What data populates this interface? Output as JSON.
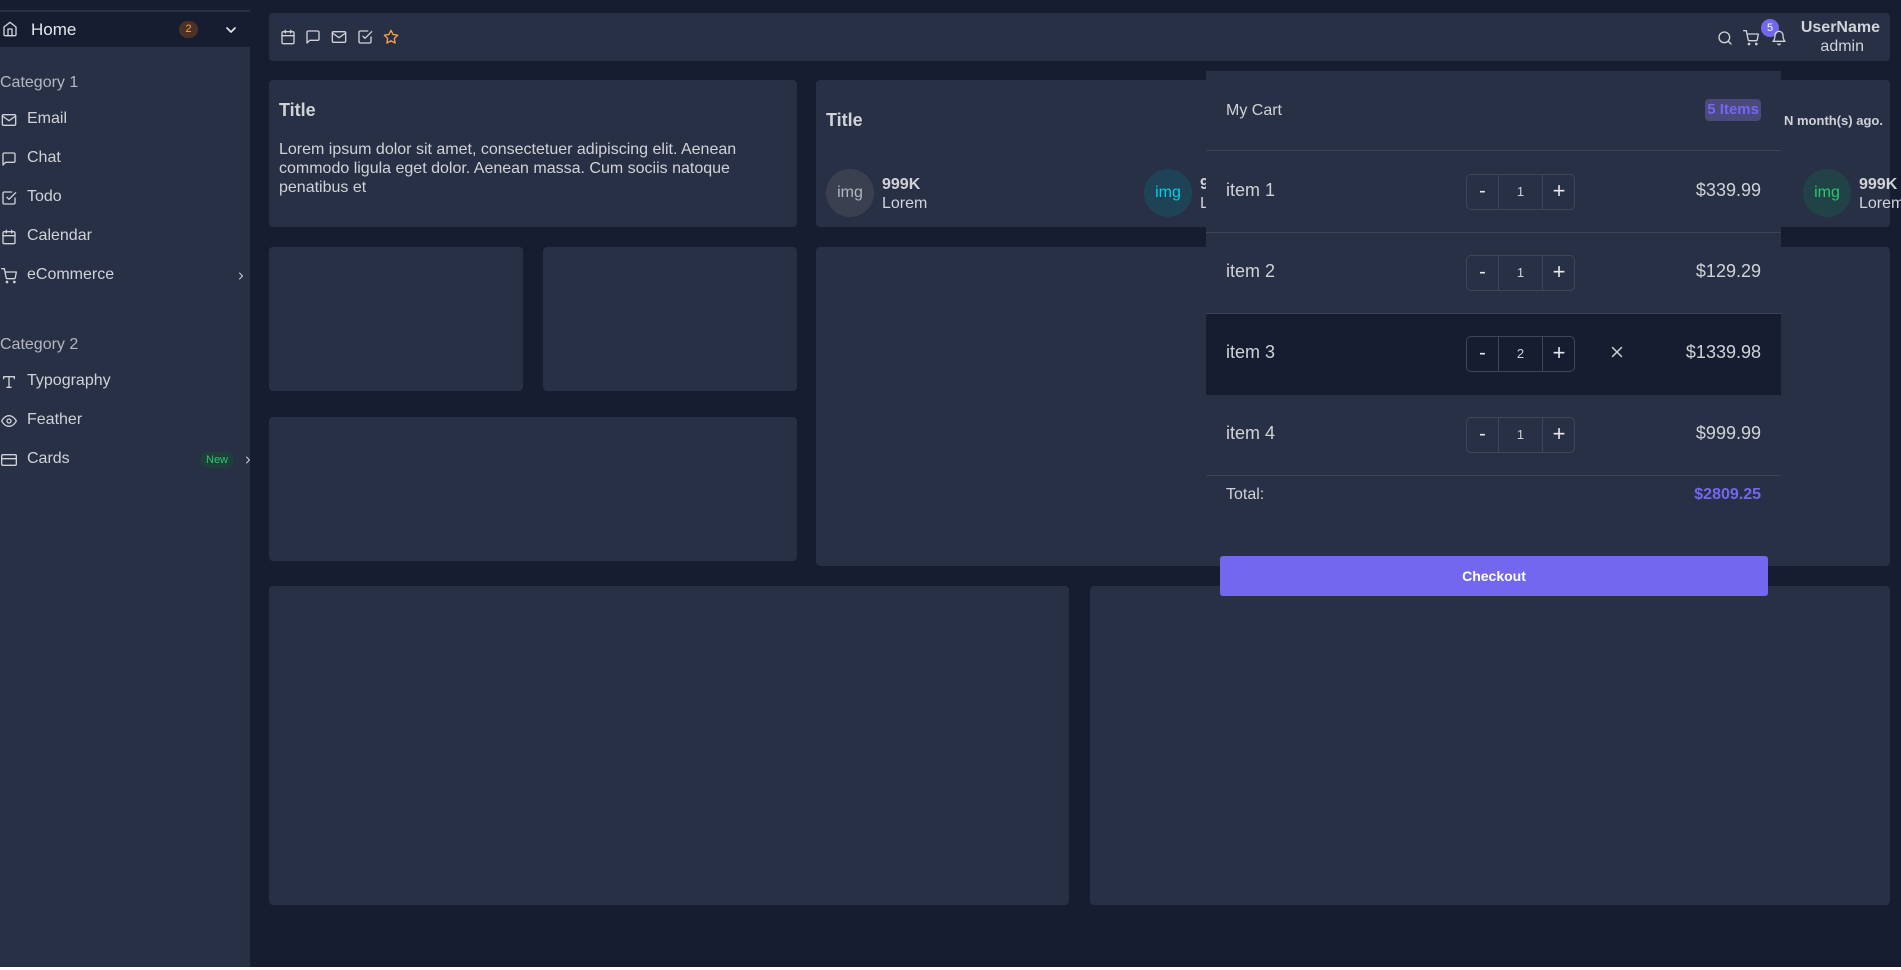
{
  "sidebar": {
    "home": {
      "label": "Home",
      "badge": "2"
    },
    "categories": [
      {
        "label": "Category 1"
      },
      {
        "label": "Category 2"
      }
    ],
    "items": [
      {
        "label": "Email",
        "icon": "mail-icon"
      },
      {
        "label": "Chat",
        "icon": "message-square-icon"
      },
      {
        "label": "Todo",
        "icon": "check-square-icon"
      },
      {
        "label": "Calendar",
        "icon": "calendar-icon"
      },
      {
        "label": "eCommerce",
        "icon": "shopping-cart-icon"
      },
      {
        "label": "Typography",
        "icon": "type-icon"
      },
      {
        "label": "Feather",
        "icon": "eye-icon"
      },
      {
        "label": "Cards",
        "icon": "credit-card-icon",
        "badge": "New"
      }
    ]
  },
  "navbar": {
    "bookmarks": [
      "calendar-icon",
      "message-square-icon",
      "mail-icon",
      "check-square-icon",
      "star-icon"
    ],
    "cart_count": "5",
    "user": {
      "name": "UserName",
      "role": "admin"
    }
  },
  "cards": {
    "card1": {
      "title": "Title",
      "text": "Lorem ipsum dolor sit amet, consectetuer adipiscing elit. Aenean commodo ligula eget dolor. Aenean massa. Cum sociis natoque penatibus et"
    },
    "card2": {
      "title": "Title",
      "updated": "N month(s) ago.",
      "stats": [
        {
          "avatar": "img",
          "value": "999K",
          "label": "Lorem",
          "color": "#82868b"
        },
        {
          "avatar": "img",
          "value": "9",
          "label": "L",
          "color": "#00cfe8"
        },
        {
          "avatar": "img",
          "value": "999K",
          "label": "Lorem",
          "color": "#28c76f"
        }
      ]
    }
  },
  "cart": {
    "title": "My Cart",
    "count_label": "5 Items",
    "items": [
      {
        "name": "item 1",
        "qty": "1",
        "price": "$339.99"
      },
      {
        "name": "item 2",
        "qty": "1",
        "price": "$129.29"
      },
      {
        "name": "item 3",
        "qty": "2",
        "price": "$1339.98"
      },
      {
        "name": "item 4",
        "qty": "1",
        "price": "$999.99"
      }
    ],
    "minus": "-",
    "plus": "+",
    "total_label": "Total:",
    "total_value": "$2809.25",
    "checkout_label": "Checkout"
  },
  "colors": {
    "bg": "#161d31",
    "card": "#283046",
    "accent": "#7367f0",
    "warning": "#ff9f43",
    "success": "#28c76f",
    "info": "#00cfe8"
  }
}
